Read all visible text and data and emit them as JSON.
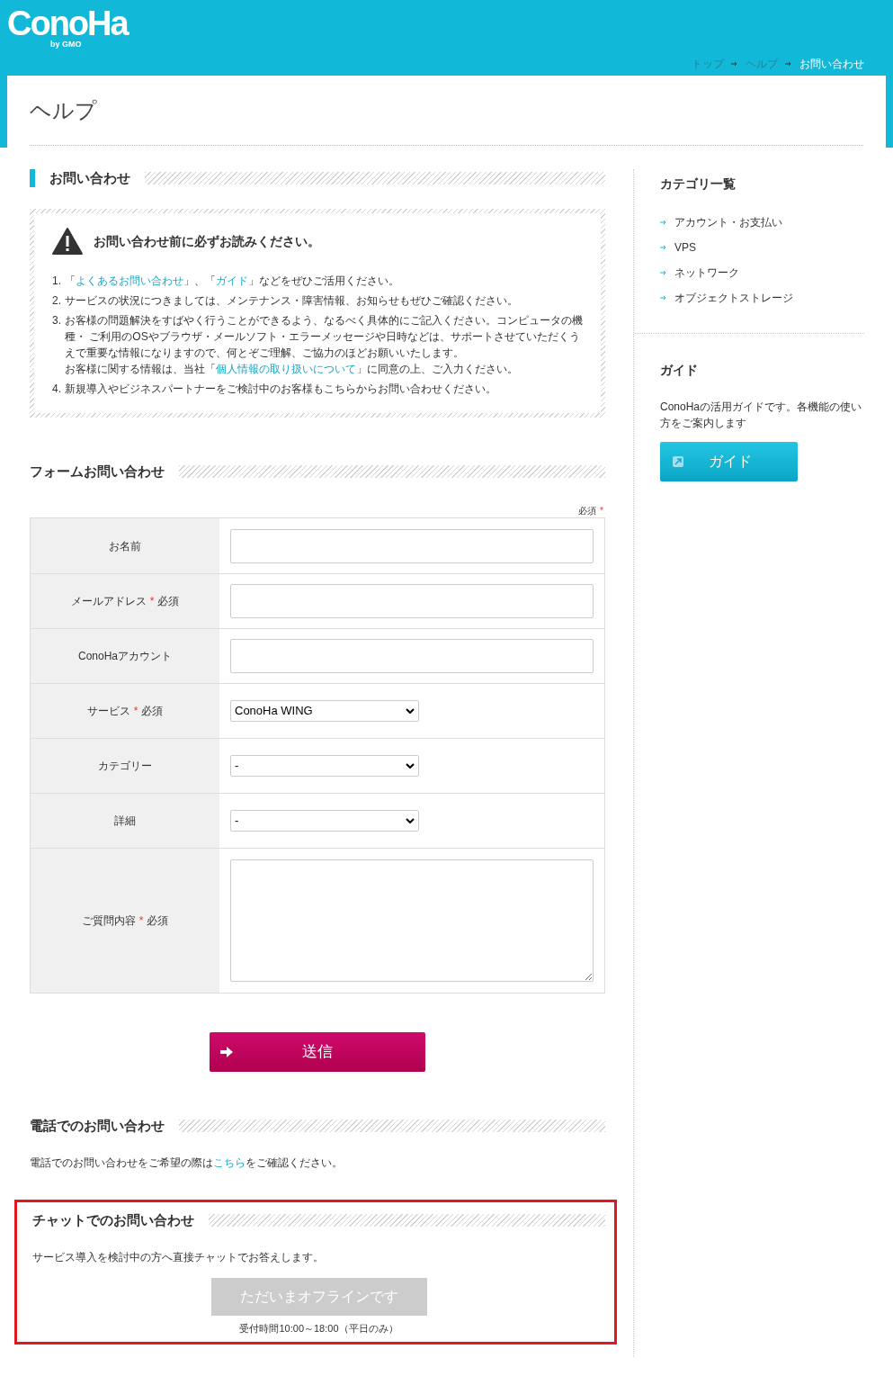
{
  "logo": {
    "text": "ConoHa",
    "sub": "by GMO"
  },
  "breadcrumb": [
    {
      "label": "トップ",
      "selected": false
    },
    {
      "label": "ヘルプ",
      "selected": false
    },
    {
      "label": "お問い合わせ",
      "selected": true
    }
  ],
  "page_title": "ヘルプ",
  "notice_section": {
    "heading": "お問い合わせ",
    "notice_title": "お問い合わせ前に必ずお読みください。",
    "items": [
      {
        "number": "1.",
        "paragraphs": [
          [
            {
              "text": "「"
            },
            {
              "text": "よくあるお問い合わせ",
              "kind": "link"
            },
            {
              "text": "」、「"
            },
            {
              "text": "ガイド",
              "kind": "link"
            },
            {
              "text": "」などをぜひご活用ください。"
            }
          ]
        ]
      },
      {
        "number": "2.",
        "paragraphs": [
          [
            {
              "text": "サービスの状況につきましては、メンテナンス・障害情報、お知らせもぜひご確認ください。"
            }
          ]
        ]
      },
      {
        "number": "3.",
        "paragraphs": [
          [
            {
              "text": "お客様の問題解決をすばやく行うことができるよう、なるべく具体的にご記入ください。コンピュータの機種・ ご利用のOSやブラウザ・メールソフト・エラーメッセージや日時などは、サポートさせていただくうえで重要な情報になりますので、何とぞご理解、ご協力のほどお願いいたします。"
            }
          ],
          [
            {
              "text": "お客様に関する情報は、当社「"
            },
            {
              "text": "個人情報の取り扱いについて",
              "kind": "link"
            },
            {
              "text": "」に同意の上、ご入力ください。"
            }
          ]
        ]
      },
      {
        "number": "4.",
        "paragraphs": [
          [
            {
              "text": "新規導入やビジネスパートナーをご検討中のお客様もこちらからお問い合わせください。"
            }
          ]
        ]
      }
    ]
  },
  "form_section": {
    "heading": "フォームお問い合わせ",
    "required_note": {
      "text": "必須",
      "mark": "*"
    },
    "rows": [
      {
        "kind": "text",
        "label": "お名前"
      },
      {
        "kind": "text",
        "label": "メールアドレス",
        "required_mark": "*",
        "required_text": "必須"
      },
      {
        "kind": "text",
        "label": "ConoHaアカウント"
      },
      {
        "kind": "select",
        "label": "サービス",
        "required_mark": "*",
        "required_text": "必須",
        "value": "ConoHa WING"
      },
      {
        "kind": "select",
        "label": "カテゴリー",
        "value": "-"
      },
      {
        "kind": "select",
        "label": "詳細",
        "value": "-"
      },
      {
        "kind": "textarea",
        "label": "ご質問内容",
        "required_mark": "*",
        "required_text": "必須"
      }
    ],
    "submit": "送信"
  },
  "phone_section": {
    "heading": "電話でのお問い合わせ",
    "text_before": "電話でのお問い合わせをご希望の際は",
    "link": "こちら",
    "text_after": "をご確認ください。"
  },
  "chat_section": {
    "heading": "チャットでのお問い合わせ",
    "highlighted": true,
    "text": "サービス導入を検討中の方へ直接チャットでお答えします。",
    "button": {
      "label": "ただいまオフラインです",
      "disabled": true
    },
    "hours": "受付時間10:00～18:00（平日のみ）"
  },
  "sidebar": {
    "categories_title": "カテゴリ一覧",
    "categories": [
      "アカウント・お支払い",
      "VPS",
      "ネットワーク",
      "オブジェクトストレージ"
    ],
    "guide_title": "ガイド",
    "guide_text": "ConoHaの活用ガイドです。各機能の使い方をご案内します",
    "guide_button": "ガイド"
  }
}
